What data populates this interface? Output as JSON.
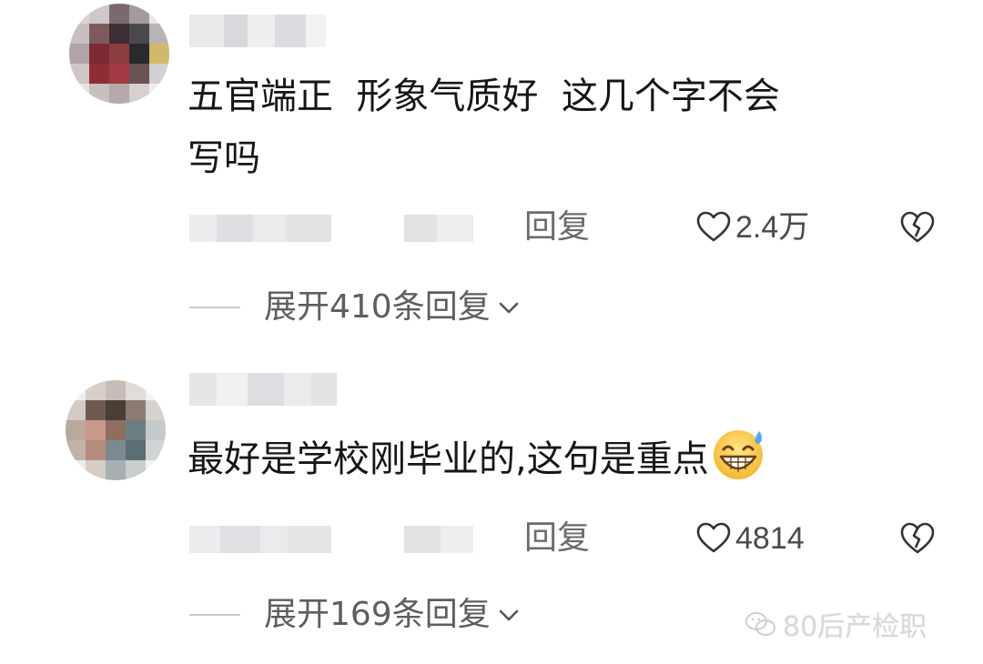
{
  "comments": [
    {
      "content": "五官端正  形象气质好  这几个字不会\n写吗",
      "reply_label": "回复",
      "like_count": "2.4万",
      "expand_label": "展开410条回复"
    },
    {
      "content": "最好是学校刚毕业的,这句是重点",
      "reply_label": "回复",
      "like_count": "4814",
      "expand_label": "展开169条回复"
    }
  ],
  "icons": {
    "like": "heart-outline-icon",
    "dislike": "broken-heart-icon",
    "expand": "chevron-down-icon",
    "emoji": "grinning-sweat-emoji",
    "watermark": "wechat-icon"
  },
  "watermark": {
    "text": "80后产检职"
  },
  "colors": {
    "text": "#161616",
    "meta": "#6b6b6b",
    "divider": "#c8c8c8"
  }
}
